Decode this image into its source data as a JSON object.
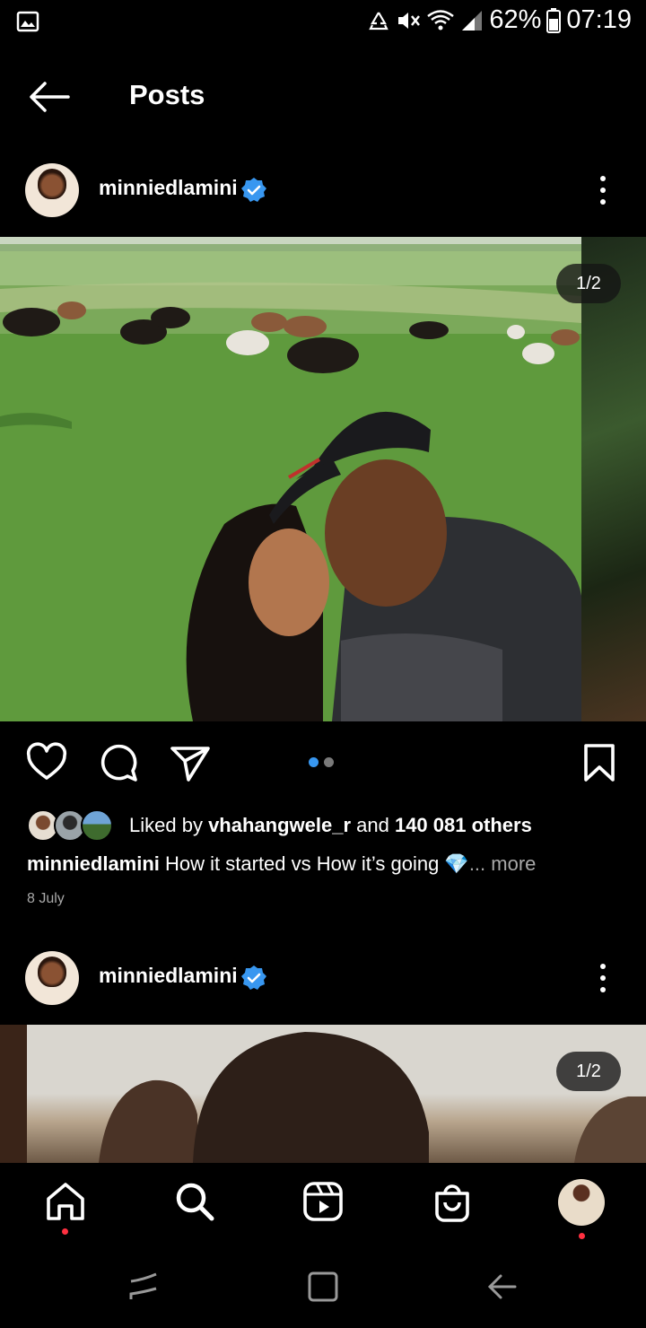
{
  "status_bar": {
    "battery": "62%",
    "time": "07:19",
    "icons": [
      "gallery-icon",
      "recycle-icon",
      "mute-icon",
      "wifi-icon",
      "signal-icon",
      "battery-icon"
    ]
  },
  "header": {
    "title": "Posts",
    "back_icon": "arrow-left-icon"
  },
  "posts": [
    {
      "username": "minniedlamini",
      "verified": true,
      "counter": "1/2",
      "liked_prefix": "Liked by ",
      "liked_user": "vhahangwele_r",
      "liked_mid": " and ",
      "liked_count": "140 081 others",
      "caption_user": "minniedlamini",
      "caption_text": " How it started vs How it’s going 💎",
      "caption_more": "... more",
      "date": "8 July"
    },
    {
      "username": "minniedlamini",
      "verified": true,
      "counter": "1/2"
    }
  ],
  "carousel": {
    "count": 2,
    "active": 0
  },
  "bottom_nav": [
    "home-icon",
    "search-icon",
    "reels-icon",
    "shop-icon",
    "profile-avatar"
  ],
  "colors": {
    "accent": "#3897f0",
    "verified": "#3897f0",
    "notification": "#ff3040"
  }
}
